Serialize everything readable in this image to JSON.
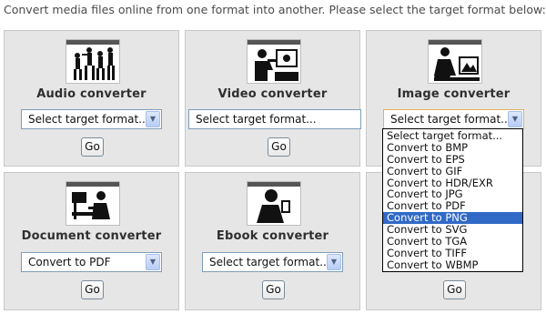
{
  "intro": "Convert media files online from one format into another. Please select the target format below:",
  "converters": [
    {
      "title": "Audio converter",
      "select": "Select target format...",
      "go": "Go",
      "icon": "dancers-icon"
    },
    {
      "title": "Video converter",
      "select": "Select target format...",
      "go": "Go",
      "icon": "video-viewer-icon"
    },
    {
      "title": "Image converter",
      "select": "Select target format...",
      "go": "Go",
      "icon": "image-viewer-icon"
    },
    {
      "title": "Document converter",
      "select": "Convert to PDF",
      "go": "Go",
      "icon": "document-reader-icon"
    },
    {
      "title": "Ebook converter",
      "select": "Select target format...",
      "go": "Go",
      "icon": "ebook-reader-icon"
    },
    {
      "title": "",
      "select": "",
      "go": "Go",
      "icon": ""
    }
  ],
  "dropdown": {
    "options": [
      "Select target format...",
      "Convert to BMP",
      "Convert to EPS",
      "Convert to GIF",
      "Convert to HDR/EXR",
      "Convert to JPG",
      "Convert to PDF",
      "Convert to PNG",
      "Convert to SVG",
      "Convert to TGA",
      "Convert to TIFF",
      "Convert to WBMP"
    ],
    "highlighted": "Convert to PNG"
  },
  "colors": {
    "highlight": "#3169c6",
    "panel": "#e6e6e6"
  }
}
